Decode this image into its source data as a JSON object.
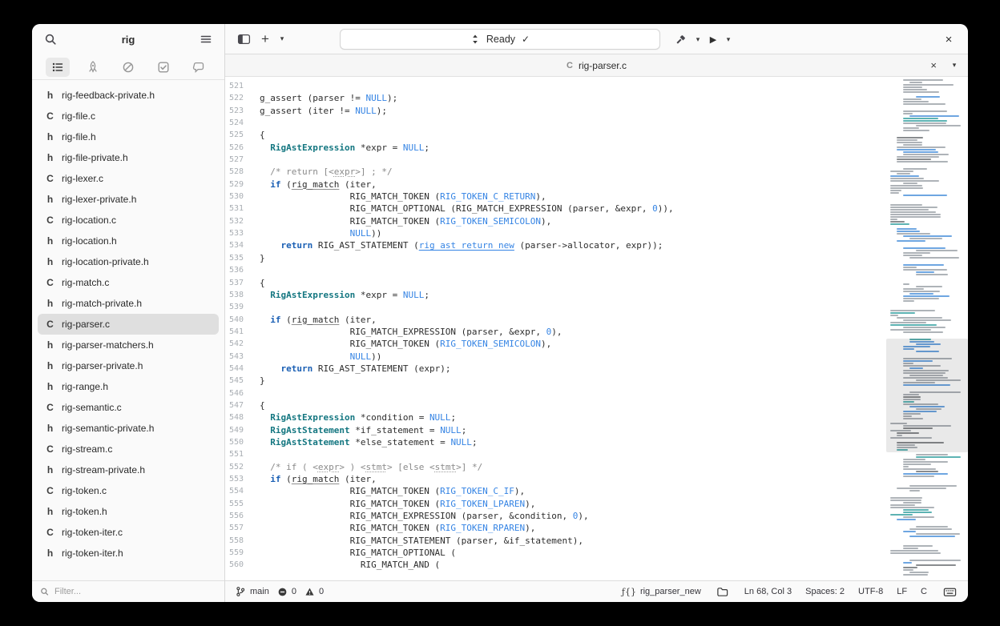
{
  "icons": {
    "plus": "+",
    "caret": "▾",
    "check": "✓",
    "play": "▶",
    "close": "×"
  },
  "sidebar": {
    "title": "rig",
    "filter_placeholder": "Filter...",
    "files": [
      {
        "badge": "h",
        "name": "rig-feedback-private.h"
      },
      {
        "badge": "C",
        "name": "rig-file.c"
      },
      {
        "badge": "h",
        "name": "rig-file.h"
      },
      {
        "badge": "h",
        "name": "rig-file-private.h"
      },
      {
        "badge": "C",
        "name": "rig-lexer.c"
      },
      {
        "badge": "h",
        "name": "rig-lexer-private.h"
      },
      {
        "badge": "C",
        "name": "rig-location.c"
      },
      {
        "badge": "h",
        "name": "rig-location.h"
      },
      {
        "badge": "h",
        "name": "rig-location-private.h"
      },
      {
        "badge": "C",
        "name": "rig-match.c"
      },
      {
        "badge": "h",
        "name": "rig-match-private.h"
      },
      {
        "badge": "C",
        "name": "rig-parser.c",
        "selected": true
      },
      {
        "badge": "h",
        "name": "rig-parser-matchers.h"
      },
      {
        "badge": "h",
        "name": "rig-parser-private.h"
      },
      {
        "badge": "h",
        "name": "rig-range.h"
      },
      {
        "badge": "C",
        "name": "rig-semantic.c"
      },
      {
        "badge": "h",
        "name": "rig-semantic-private.h"
      },
      {
        "badge": "C",
        "name": "rig-stream.c"
      },
      {
        "badge": "h",
        "name": "rig-stream-private.h"
      },
      {
        "badge": "C",
        "name": "rig-token.c"
      },
      {
        "badge": "h",
        "name": "rig-token.h"
      },
      {
        "badge": "C",
        "name": "rig-token-iter.c"
      },
      {
        "badge": "h",
        "name": "rig-token-iter.h"
      }
    ]
  },
  "header": {
    "omnibar_status": "Ready"
  },
  "tabbar": {
    "file_badge": "C",
    "file_name": "rig-parser.c"
  },
  "editor": {
    "syntax_colors": {
      "keyword": "#1a5fb4",
      "type": "#137680",
      "constant": "#3584e4",
      "comment": "#8a8a8a"
    },
    "lines": [
      {
        "n": 521,
        "s": []
      },
      {
        "n": 522,
        "s": [
          [
            "g_assert (parser != "
          ],
          [
            "NULL",
            "c"
          ],
          [
            ");"
          ]
        ]
      },
      {
        "n": 523,
        "s": [
          [
            "g_assert (iter != "
          ],
          [
            "NULL",
            "c"
          ],
          [
            ");"
          ]
        ]
      },
      {
        "n": 524,
        "s": []
      },
      {
        "n": 525,
        "s": [
          [
            "{"
          ]
        ]
      },
      {
        "n": 526,
        "s": [
          [
            "  "
          ],
          [
            "RigAstExpression",
            "t"
          ],
          [
            " *expr = "
          ],
          [
            "NULL",
            "c"
          ],
          [
            ";"
          ]
        ]
      },
      {
        "n": 527,
        "s": []
      },
      {
        "n": 528,
        "s": [
          [
            "  "
          ],
          [
            "/* return [<",
            "m"
          ],
          [
            "expr",
            "mu"
          ],
          [
            ">] ; */",
            "m"
          ]
        ]
      },
      {
        "n": 529,
        "s": [
          [
            "  "
          ],
          [
            "if",
            "k"
          ],
          [
            " ("
          ],
          [
            "rig_match",
            "u"
          ],
          [
            " (iter,"
          ]
        ]
      },
      {
        "n": 530,
        "s": [
          [
            "                 RIG_MATCH_TOKEN ("
          ],
          [
            "RIG_TOKEN_C_RETURN",
            "c"
          ],
          [
            "),"
          ]
        ]
      },
      {
        "n": 531,
        "s": [
          [
            "                 RIG_MATCH_OPTIONAL (RIG_MATCH_EXPRESSION (parser, &expr, "
          ],
          [
            "0",
            "c"
          ],
          [
            ")),"
          ]
        ]
      },
      {
        "n": 532,
        "s": [
          [
            "                 RIG_MATCH_TOKEN ("
          ],
          [
            "RIG_TOKEN_SEMICOLON",
            "c"
          ],
          [
            "),"
          ]
        ]
      },
      {
        "n": 533,
        "s": [
          [
            "                 "
          ],
          [
            "NULL",
            "c"
          ],
          [
            "))"
          ]
        ]
      },
      {
        "n": 534,
        "s": [
          [
            "    "
          ],
          [
            "return",
            "k"
          ],
          [
            " RIG_AST_STATEMENT ("
          ],
          [
            "rig_ast_return_new",
            "l"
          ],
          [
            " (parser->allocator, expr));"
          ]
        ]
      },
      {
        "n": 535,
        "s": [
          [
            "}"
          ]
        ]
      },
      {
        "n": 536,
        "s": []
      },
      {
        "n": 537,
        "s": [
          [
            "{"
          ]
        ]
      },
      {
        "n": 538,
        "s": [
          [
            "  "
          ],
          [
            "RigAstExpression",
            "t"
          ],
          [
            " *expr = "
          ],
          [
            "NULL",
            "c"
          ],
          [
            ";"
          ]
        ]
      },
      {
        "n": 539,
        "s": []
      },
      {
        "n": 540,
        "s": [
          [
            "  "
          ],
          [
            "if",
            "k"
          ],
          [
            " ("
          ],
          [
            "rig_match",
            "u"
          ],
          [
            " (iter,"
          ]
        ]
      },
      {
        "n": 541,
        "s": [
          [
            "                 RIG_MATCH_EXPRESSION (parser, &expr, "
          ],
          [
            "0",
            "c"
          ],
          [
            "),"
          ]
        ]
      },
      {
        "n": 542,
        "s": [
          [
            "                 RIG_MATCH_TOKEN ("
          ],
          [
            "RIG_TOKEN_SEMICOLON",
            "c"
          ],
          [
            "),"
          ]
        ]
      },
      {
        "n": 543,
        "s": [
          [
            "                 "
          ],
          [
            "NULL",
            "c"
          ],
          [
            "))"
          ]
        ]
      },
      {
        "n": 544,
        "s": [
          [
            "    "
          ],
          [
            "return",
            "k"
          ],
          [
            " RIG_AST_STATEMENT (expr);"
          ]
        ]
      },
      {
        "n": 545,
        "s": [
          [
            "}"
          ]
        ]
      },
      {
        "n": 546,
        "s": []
      },
      {
        "n": 547,
        "s": [
          [
            "{"
          ]
        ]
      },
      {
        "n": 548,
        "s": [
          [
            "  "
          ],
          [
            "RigAstExpression",
            "t"
          ],
          [
            " *condition = "
          ],
          [
            "NULL",
            "c"
          ],
          [
            ";"
          ]
        ]
      },
      {
        "n": 549,
        "s": [
          [
            "  "
          ],
          [
            "RigAstStatement",
            "t"
          ],
          [
            " *if_statement = "
          ],
          [
            "NULL",
            "c"
          ],
          [
            ";"
          ]
        ]
      },
      {
        "n": 550,
        "s": [
          [
            "  "
          ],
          [
            "RigAstStatement",
            "t"
          ],
          [
            " *else_statement = "
          ],
          [
            "NULL",
            "c"
          ],
          [
            ";"
          ]
        ]
      },
      {
        "n": 551,
        "s": []
      },
      {
        "n": 552,
        "s": [
          [
            "  "
          ],
          [
            "/* if ( <",
            "m"
          ],
          [
            "expr",
            "mu"
          ],
          [
            "> ) <",
            "m"
          ],
          [
            "stmt",
            "mu"
          ],
          [
            "> [else <",
            "m"
          ],
          [
            "stmt",
            "mu"
          ],
          [
            ">] */",
            "m"
          ]
        ]
      },
      {
        "n": 553,
        "s": [
          [
            "  "
          ],
          [
            "if",
            "k"
          ],
          [
            " ("
          ],
          [
            "rig_match",
            "u"
          ],
          [
            " (iter,"
          ]
        ]
      },
      {
        "n": 554,
        "s": [
          [
            "                 RIG_MATCH_TOKEN ("
          ],
          [
            "RIG_TOKEN_C_IF",
            "c"
          ],
          [
            "),"
          ]
        ]
      },
      {
        "n": 555,
        "s": [
          [
            "                 RIG_MATCH_TOKEN ("
          ],
          [
            "RIG_TOKEN_LPAREN",
            "c"
          ],
          [
            "),"
          ]
        ]
      },
      {
        "n": 556,
        "s": [
          [
            "                 RIG_MATCH_EXPRESSION (parser, &condition, "
          ],
          [
            "0",
            "c"
          ],
          [
            "),"
          ]
        ]
      },
      {
        "n": 557,
        "s": [
          [
            "                 RIG_MATCH_TOKEN ("
          ],
          [
            "RIG_TOKEN_RPAREN",
            "c"
          ],
          [
            "),"
          ]
        ]
      },
      {
        "n": 558,
        "s": [
          [
            "                 RIG_MATCH_STATEMENT (parser, &if_statement),"
          ]
        ]
      },
      {
        "n": 559,
        "s": [
          [
            "                 RIG_MATCH_OPTIONAL ("
          ]
        ]
      },
      {
        "n": 560,
        "s": [
          [
            "                   RIG_MATCH_AND ("
          ]
        ]
      }
    ]
  },
  "minimap": {
    "seed": 137,
    "viewport_top_pct": 52,
    "viewport_height_pct": 22.5,
    "colors": {
      "gray": "#9aa0a6",
      "blue": "#4a90d9",
      "teal": "#35a0a0",
      "dark": "#6b6f73"
    }
  },
  "statusbar": {
    "branch": "main",
    "error_count": "0",
    "warning_count": "0",
    "symbol_glyph": "ƒ{}",
    "symbol": "rig_parser_new",
    "position": "Ln 68, Col 3",
    "spaces": "Spaces: 2",
    "encoding": "UTF-8",
    "line_ending": "LF",
    "language": "C"
  }
}
